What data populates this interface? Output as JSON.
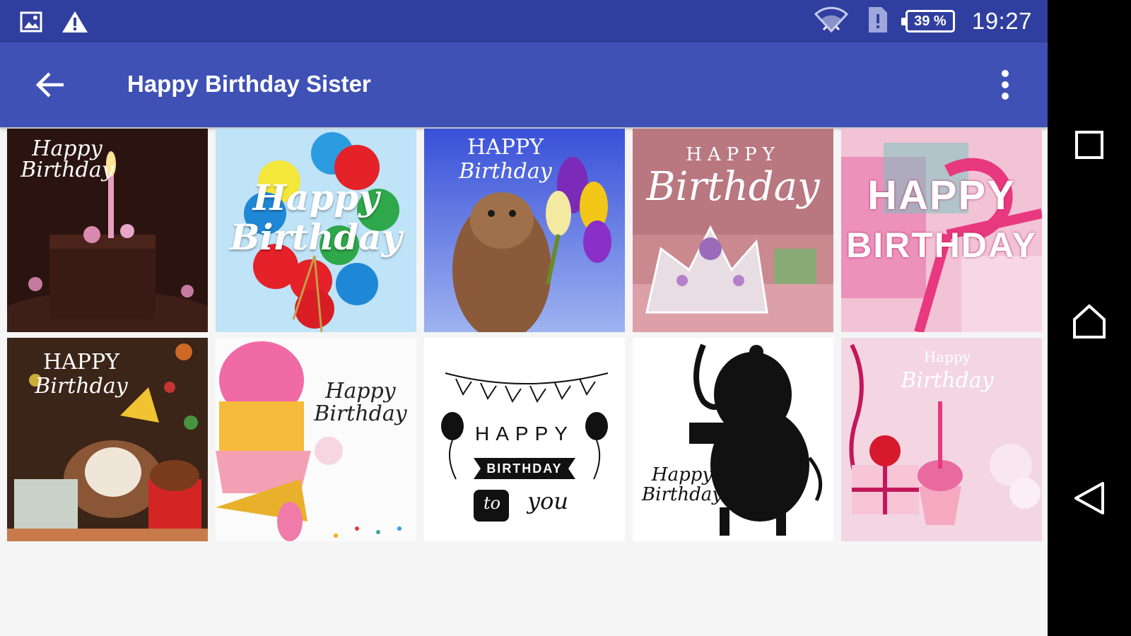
{
  "status_bar": {
    "left_icons": [
      "image-icon",
      "warning-icon"
    ],
    "right_icons": [
      "wifi-icon",
      "sim-alert-icon",
      "battery-icon"
    ],
    "battery": "39 %",
    "time": "19:27"
  },
  "app_bar": {
    "title": "Happy Birthday Sister",
    "back_icon": "arrow-back-icon",
    "menu_icon": "more-vert-icon"
  },
  "cards": [
    {
      "line1": "Happy",
      "line2": "Birthday"
    },
    {
      "line1": "Happy",
      "line2": "Birthday"
    },
    {
      "line1": "HAPPY",
      "line2": "Birthday"
    },
    {
      "line1": "HAPPY",
      "line2": "Birthday"
    },
    {
      "line1": "HAPPY",
      "line2": "BIRTHDAY"
    },
    {
      "line1": "HAPPY",
      "line2": "Birthday"
    },
    {
      "line1": "Happy",
      "line2": "Birthday"
    },
    {
      "line1": "HAPPY",
      "line2": "BIRTHDAY",
      "line3": "to",
      "line4": "you"
    },
    {
      "line1": "Happy",
      "line2": "Birthday"
    },
    {
      "line1": "Happy",
      "line2": "Birthday"
    }
  ],
  "nav_bar": {
    "icons": [
      "recents-square-icon",
      "home-icon",
      "back-triangle-icon"
    ]
  },
  "colors": {
    "status_bar": "#303f9f",
    "app_bar": "#3f51b5",
    "background": "#f5f5f5"
  }
}
